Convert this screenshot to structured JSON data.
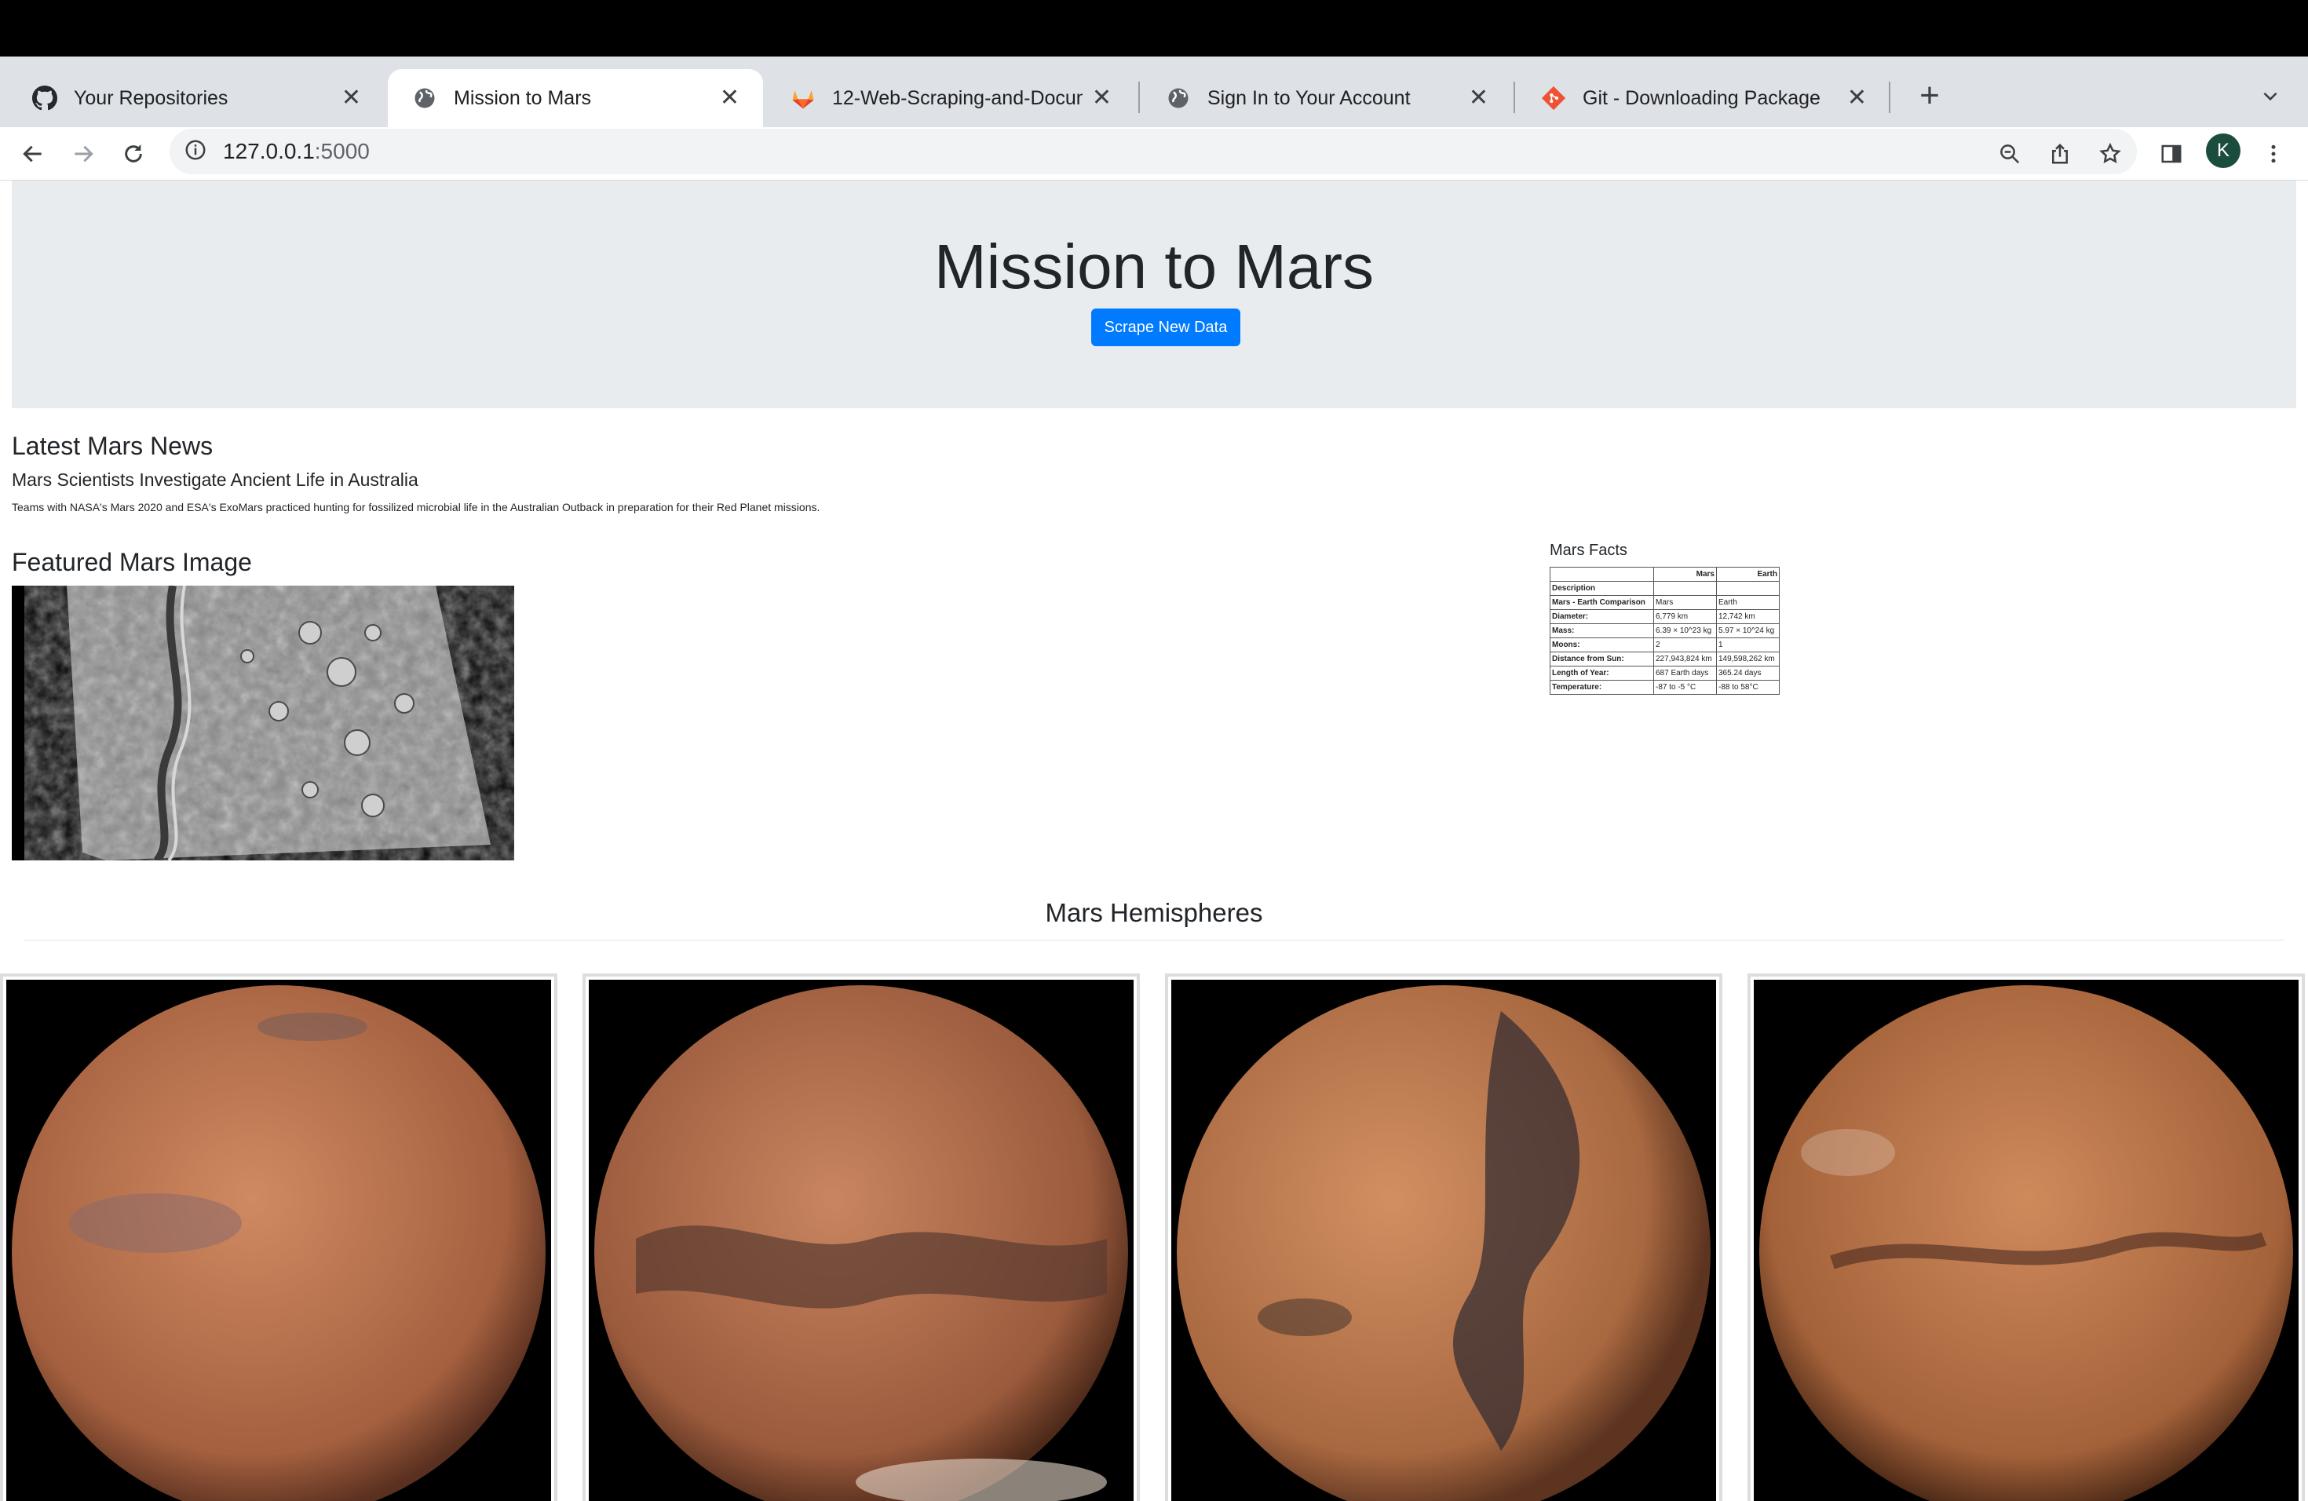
{
  "browser": {
    "tabs": [
      {
        "title": "Your Repositories",
        "icon": "github-icon",
        "active": false
      },
      {
        "title": "Mission to Mars",
        "icon": "globe-icon",
        "active": true
      },
      {
        "title": "12-Web-Scraping-and-Docum",
        "icon": "gitlab-icon",
        "active": false
      },
      {
        "title": "Sign In to Your Account",
        "icon": "globe-icon",
        "active": false
      },
      {
        "title": "Git - Downloading Package",
        "icon": "git-icon",
        "active": false
      }
    ],
    "url_host": "127.0.0.1",
    "url_port": ":5000",
    "profile_initial": "K"
  },
  "page": {
    "title": "Mission to Mars",
    "scrape_button": "Scrape New Data",
    "news_heading": "Latest Mars News",
    "news_title": "Mars Scientists Investigate Ancient Life in Australia",
    "news_paragraph": "Teams with NASA's Mars 2020 and ESA's ExoMars practiced hunting for fossilized microbial life in the Australian Outback in preparation for their Red Planet missions.",
    "image_heading": "Featured Mars Image",
    "facts_heading": "Mars Facts",
    "facts_table": {
      "headers": [
        "",
        "Mars",
        "Earth"
      ],
      "rows": [
        [
          "Description",
          "",
          ""
        ],
        [
          "Mars - Earth Comparison",
          "Mars",
          "Earth"
        ],
        [
          "Diameter:",
          "6,779 km",
          "12,742 km"
        ],
        [
          "Mass:",
          "6.39 × 10^23 kg",
          "5.97 × 10^24 kg"
        ],
        [
          "Moons:",
          "2",
          "1"
        ],
        [
          "Distance from Sun:",
          "227,943,824 km",
          "149,598,262 km"
        ],
        [
          "Length of Year:",
          "687 Earth days",
          "365.24 days"
        ],
        [
          "Temperature:",
          "-87 to -5 °C",
          "-88 to 58°C"
        ]
      ]
    },
    "hemispheres_heading": "Mars Hemispheres"
  },
  "colors": {
    "accent": "#007bff",
    "jumbotron_bg": "#e9ecef",
    "tabstrip_bg": "#dee1e6"
  }
}
